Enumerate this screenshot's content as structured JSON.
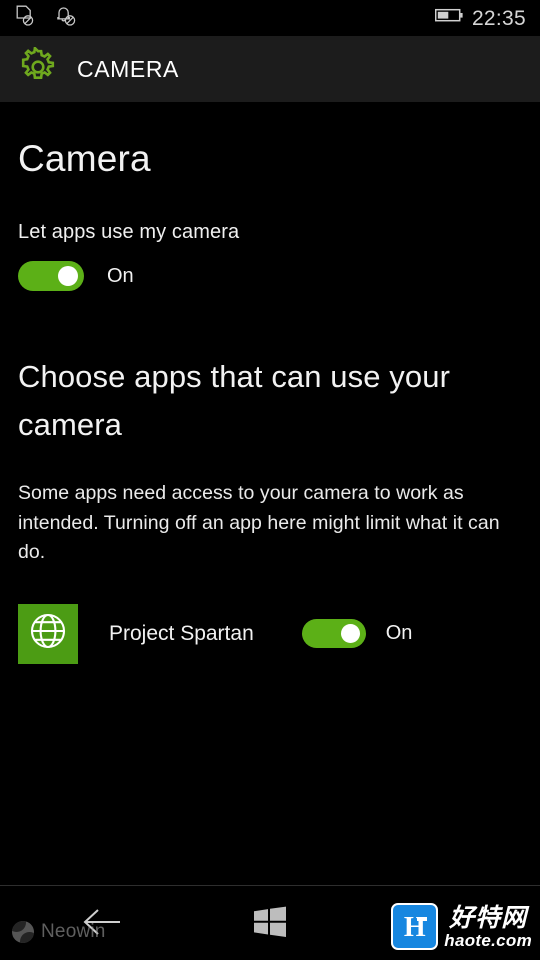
{
  "status_bar": {
    "icons": [
      "sim-no-icon",
      "notifications-off-icon",
      "battery-icon"
    ],
    "time": "22:35"
  },
  "header": {
    "icon": "settings-gear-icon",
    "title": "CAMERA"
  },
  "page": {
    "title": "Camera",
    "master_toggle": {
      "label": "Let apps use my camera",
      "state_label": "On",
      "on": true
    },
    "section": {
      "heading": "Choose apps that can use your camera",
      "description": "Some apps need access to your camera to work as intended. Turning off an app here might limit what it can do."
    },
    "apps": [
      {
        "name": "Project Spartan",
        "icon": "globe-icon",
        "tile_color": "#4c9c14",
        "state_label": "On",
        "on": true
      }
    ]
  },
  "nav_bar": {
    "back": "back-arrow-icon",
    "start": "windows-start-icon"
  },
  "watermarks": {
    "neowin": "Neowin",
    "haote_cn": "好特网",
    "haote_url": "haote.com"
  },
  "colors": {
    "accent_green": "#5cb017",
    "header_bg": "#1c1c1c",
    "background": "#000000",
    "gear_green": "#6fa81e",
    "haote_blue": "#1787e0"
  }
}
